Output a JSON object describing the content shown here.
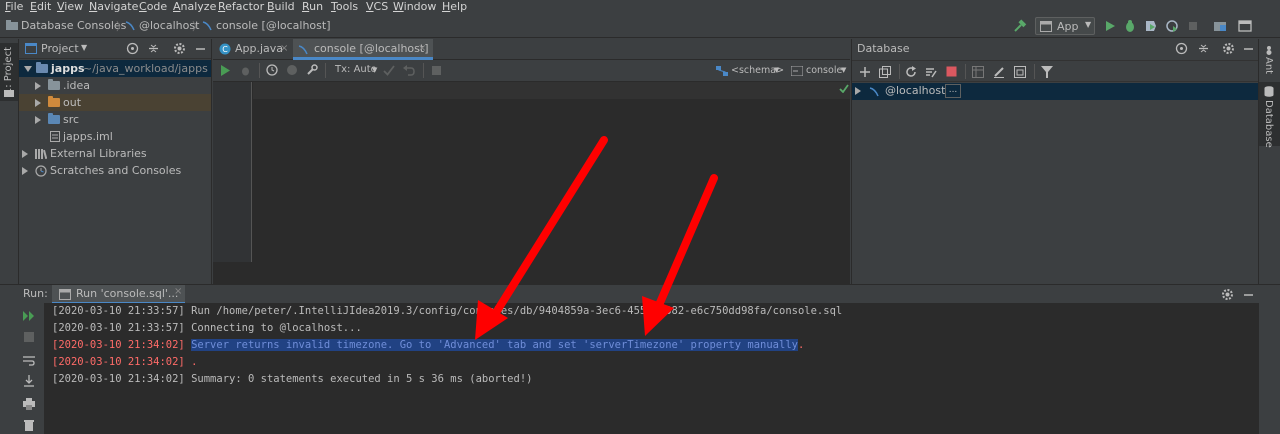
{
  "menu": [
    "File",
    "Edit",
    "View",
    "Navigate",
    "Code",
    "Analyze",
    "Refactor",
    "Build",
    "Run",
    "Tools",
    "VCS",
    "Window",
    "Help"
  ],
  "breadcrumb": [
    "Database Consoles",
    "@localhost",
    "console [@localhost]"
  ],
  "run_config": "App",
  "left_stripe": {
    "project_label": "1: Project"
  },
  "right_stripe": {
    "ant_label": "Ant",
    "database_label": "Database"
  },
  "project_panel": {
    "title": "Project",
    "tree": [
      {
        "name": "japps",
        "path": "~/java_workload/japps"
      },
      {
        "name": ".idea"
      },
      {
        "name": "out"
      },
      {
        "name": "src"
      },
      {
        "name": "japps.iml"
      },
      {
        "name": "External Libraries"
      },
      {
        "name": "Scratches and Consoles"
      }
    ]
  },
  "editor": {
    "tabs": [
      {
        "label": "App.java"
      },
      {
        "label": "console [@localhost]"
      }
    ],
    "tx_mode": "Tx: Auto",
    "schema_label": "<schema>",
    "console_label": "console"
  },
  "database_panel": {
    "title": "Database",
    "root_item": "@localhost",
    "ellipsis": "..."
  },
  "run_panel": {
    "label": "Run:",
    "tab_label": "Run 'console.sql'...",
    "lines": [
      {
        "timestamp": "[2020-03-10 21:33:57]",
        "message": "Run /home/peter/.IntelliJIdea2019.3/config/consoles/db/9404859a-3ec6-4555-8382-e6c750dd98fa/console.sql",
        "error": false
      },
      {
        "timestamp": "[2020-03-10 21:33:57]",
        "message": "Connecting to @localhost...",
        "error": false
      },
      {
        "timestamp": "[2020-03-10 21:34:02]",
        "message": "Server returns invalid timezone. Go to 'Advanced' tab and set 'serverTimezone' property manually",
        "suffix": ".",
        "error": true
      },
      {
        "timestamp": "[2020-03-10 21:34:02]",
        "message": ".",
        "error": true
      },
      {
        "timestamp": "[2020-03-10 21:34:02]",
        "message": "Summary: 0 statements executed in 5 s 36 ms (aborted!)",
        "error": false
      }
    ]
  },
  "colors": {
    "accent": "#4a88c7",
    "error": "#ff6b68",
    "highlight_bg": "#214283",
    "annotation_arrow": "#ff0000"
  }
}
